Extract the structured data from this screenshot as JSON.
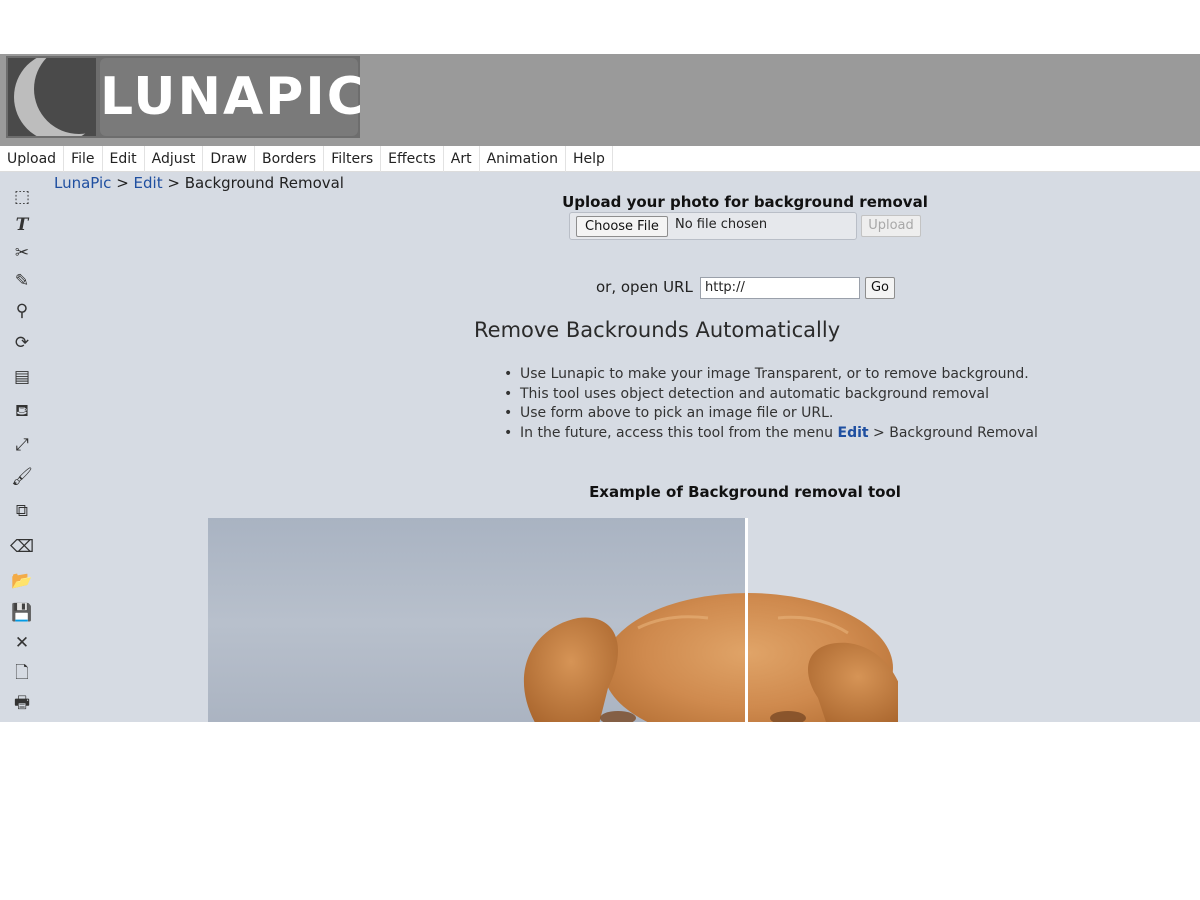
{
  "header": {
    "logo_text": "LUNAPIC",
    "logo_icon": "crescent-moon-icon"
  },
  "menu": [
    {
      "label": "Upload"
    },
    {
      "label": "File"
    },
    {
      "label": "Edit"
    },
    {
      "label": "Adjust"
    },
    {
      "label": "Draw"
    },
    {
      "label": "Borders"
    },
    {
      "label": "Filters"
    },
    {
      "label": "Effects"
    },
    {
      "label": "Art"
    },
    {
      "label": "Animation"
    },
    {
      "label": "Help"
    }
  ],
  "toolbar": {
    "tools": [
      {
        "icon": "selection-icon",
        "glyph": "⬚"
      },
      {
        "icon": "text-icon",
        "glyph": "T"
      },
      {
        "icon": "scissors-icon",
        "glyph": "✂"
      },
      {
        "icon": "pencil-icon",
        "glyph": "✎"
      },
      {
        "icon": "zoom-icon",
        "glyph": "⚲"
      },
      {
        "icon": "rotate-icon",
        "glyph": "⟳"
      },
      {
        "icon": "layer-icon",
        "glyph": "▤"
      },
      {
        "icon": "paint-bucket-icon",
        "glyph": "⛾"
      },
      {
        "icon": "eyedropper-icon",
        "glyph": "⤢"
      },
      {
        "icon": "brush-icon",
        "glyph": "🖌"
      },
      {
        "icon": "crop-icon",
        "glyph": "⧉"
      },
      {
        "icon": "eraser-icon",
        "glyph": "⌫"
      },
      {
        "icon": "open-folder-icon",
        "glyph": "📂"
      },
      {
        "icon": "save-icon",
        "glyph": "💾"
      },
      {
        "icon": "close-icon",
        "glyph": "✕"
      },
      {
        "icon": "new-page-icon",
        "glyph": "🗋"
      },
      {
        "icon": "print-icon",
        "glyph": "🖶"
      }
    ]
  },
  "breadcrumb": {
    "home": "LunaPic",
    "sep1": " > ",
    "section": "Edit",
    "sep2": " > ",
    "current": "Background Removal"
  },
  "upload": {
    "title": "Upload your photo for background removal",
    "choose_label": "Choose File",
    "file_status": "No file chosen",
    "upload_label": "Upload"
  },
  "url": {
    "label": "or, open URL",
    "value": "http://",
    "go_label": "Go"
  },
  "heading": "Remove Backrounds Automatically",
  "bullets": {
    "b1": "Use Lunapic to make your image Transparent, or to remove background.",
    "b2": "This tool uses object detection and automatic background removal",
    "b3": "Use form above to pick an image file or URL.",
    "b4_prefix": "In the future, access this tool from the menu ",
    "b4_link": "Edit",
    "b4_suffix": " > Background Removal"
  },
  "example": {
    "title": "Example of Background removal tool"
  },
  "colors": {
    "header_bg": "#9a9a9a",
    "main_bg": "#d6dbe3",
    "link": "#1f4fa0"
  }
}
